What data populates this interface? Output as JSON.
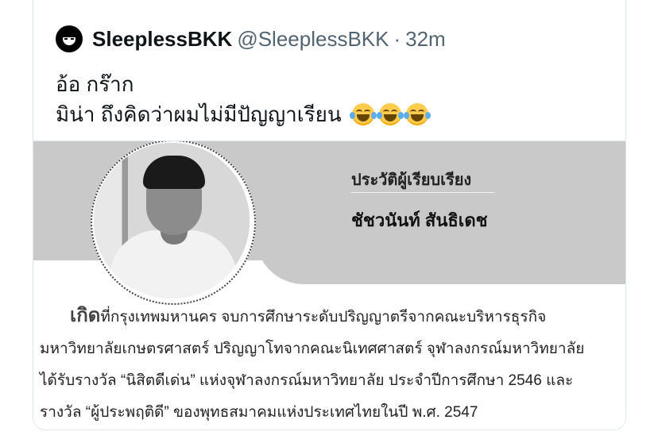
{
  "tweet": {
    "author_name": "SleeplessBKK",
    "author_handle": "@SleeplessBKK",
    "separator": "·",
    "time_ago": "32m",
    "text_line1": "อ้อ กร๊าก",
    "text_line2": "มิน่า ถึงคิดว่าผมไม่มีปัญญาเรียน",
    "emoji_count": 3,
    "emoji_icon": "face-with-tears-of-joy"
  },
  "media": {
    "label_title": "ประวัติผู้เรียบเรียง",
    "label_name": "ชัชวนันท์ สันธิเดช",
    "bio": {
      "born_word": "เกิด",
      "line1_rest": "ที่กรุงเทพมหานคร จบการศึกษาระดับปริญญาตรีจากคณะบริหารธุรกิจ",
      "line2": "มหาวิทยาลัยเกษตรศาสตร์ ปริญญาโทจากคณะนิเทศศาสตร์ จุฬาลงกรณ์มหาวิทยาลัย",
      "line3": "ได้รับรางวัล “นิสิตดีเด่น” แห่งจุฬาลงกรณ์มหาวิทยาลัย ประจำปีการศึกษา 2546 และ",
      "line4": "รางวัล “ผู้ประพฤติดี” ของพุทธสมาคมแห่งประเทศไทยในปี พ.ศ. 2547"
    }
  },
  "colors": {
    "text_primary": "#0f1419",
    "text_secondary": "#536471",
    "media_band": "#c9c9c9"
  }
}
